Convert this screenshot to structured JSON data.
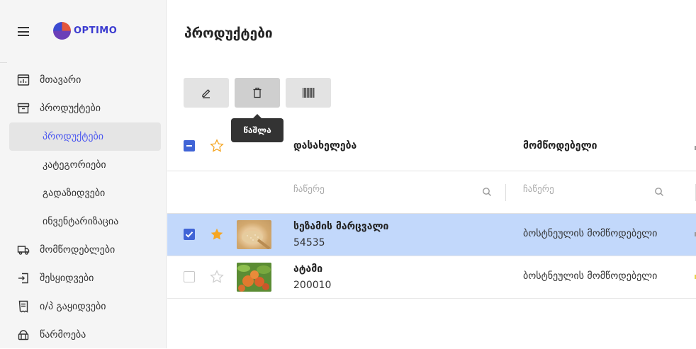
{
  "app": {
    "logo_text": "OPTIMO"
  },
  "sidebar": {
    "items": [
      {
        "label": "მთავარი",
        "icon": "dashboard-icon"
      },
      {
        "label": "პროდუქტები",
        "icon": "archive-box-icon"
      },
      {
        "label": "პროდუქტები",
        "active": true
      },
      {
        "label": "კატეგორიები"
      },
      {
        "label": "გადაზიდვები"
      },
      {
        "label": "ინვენტარიზაცია"
      },
      {
        "label": "მომწოდებლები",
        "icon": "truck-icon"
      },
      {
        "label": "შესყიდვები",
        "icon": "import-icon"
      },
      {
        "label": "ი/პ გაყიდვები",
        "icon": "receipt-icon"
      },
      {
        "label": "წარმოება",
        "icon": "factory-icon"
      }
    ]
  },
  "main": {
    "title": "პროდუქტები",
    "toolbar": {
      "edit_icon": "pencil-icon",
      "delete_icon": "trash-icon",
      "barcode_icon": "barcode-icon",
      "tooltip": "წაშლა"
    },
    "table": {
      "columns": [
        "დასახელება",
        "მომწოდებელი"
      ],
      "filter_placeholder": "ჩაწერე",
      "rows": [
        {
          "name": "სეზამის მარცვალი",
          "code": "54535",
          "supplier": "ბოსტნეულის მომწოდებელი",
          "selected": true,
          "starred": true
        },
        {
          "name": "ატამი",
          "code": "200010",
          "supplier": "ბოსტნეულის მომწოდებელი",
          "selected": false,
          "starred": false
        }
      ]
    }
  },
  "colors": {
    "accent": "#4b57f0",
    "selected_row": "#c2d8fb",
    "checkbox": "#4064d6",
    "star": "#f5a623"
  }
}
